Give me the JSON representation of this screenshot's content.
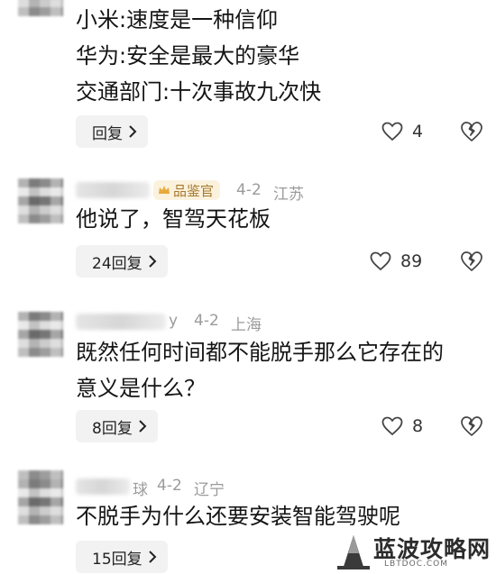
{
  "comments": [
    {
      "lines": [
        "小米:速度是一种信仰",
        "华为:安全是最大的豪华",
        "交通部门:十次事故九次快"
      ],
      "reply_label": "回复",
      "likes": "4"
    },
    {
      "badge": "品鉴官",
      "date": "4-2",
      "location": "江苏",
      "lines": [
        "他说了，智驾天花板"
      ],
      "reply_label": "24回复",
      "likes": "89"
    },
    {
      "name_fragment": "y",
      "date": "4-2",
      "location": "上海",
      "lines": [
        "既然任何时间都不能脱手那么它存在的",
        "意义是什么？"
      ],
      "reply_label": "8回复",
      "likes": "8"
    },
    {
      "name_fragment": "球",
      "date": "4-2",
      "location": "辽宁",
      "lines": [
        "不脱手为什么还要安装智能驾驶呢"
      ],
      "reply_label": "15回复"
    }
  ],
  "watermark": {
    "title": "蓝波攻略网",
    "url": "LBTDOC.COM"
  },
  "colors": {
    "meta_gray": "#9b9b9b",
    "badge_bg": "#fbf2de",
    "badge_text": "#a5782d",
    "button_bg": "#f2f2f2"
  }
}
